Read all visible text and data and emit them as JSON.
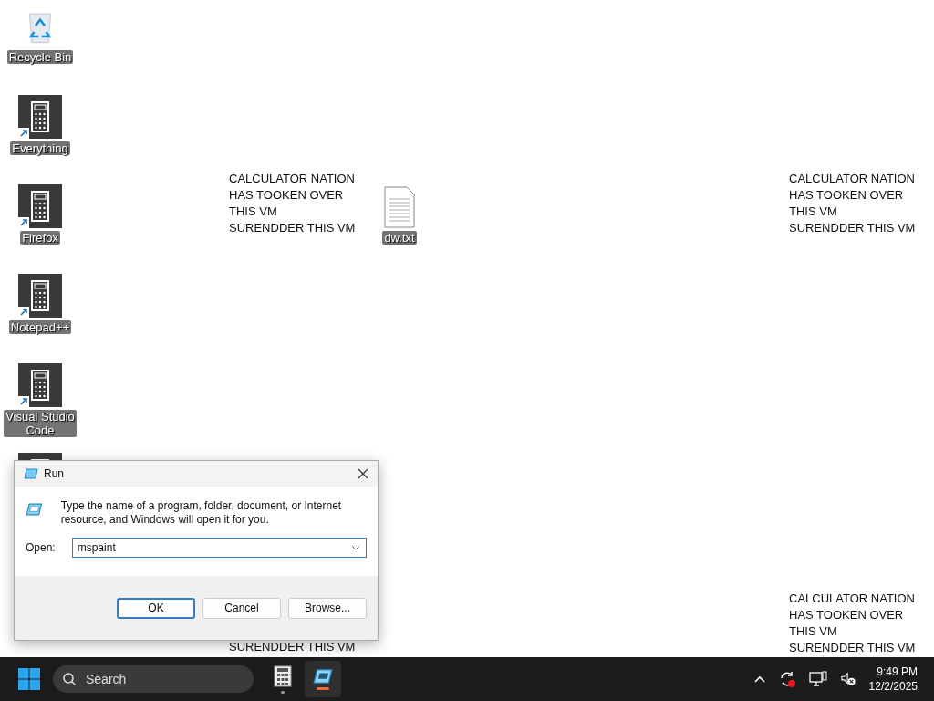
{
  "desktop_icons": [
    {
      "kind": "recycle",
      "label": "Recycle Bin"
    },
    {
      "kind": "app",
      "label": "Everything",
      "shortcut": true
    },
    {
      "kind": "app",
      "label": "Firefox",
      "shortcut": true
    },
    {
      "kind": "app",
      "label": "Notepad++",
      "shortcut": true
    },
    {
      "kind": "app",
      "label": "Visual Studio Code",
      "shortcut": true
    },
    {
      "kind": "app"
    },
    {
      "kind": "file",
      "label": "dw.txt"
    }
  ],
  "desktop_notes": [
    {
      "text": "CALCULATOR NATION\nHAS TOOKEN OVER\nTHIS VM\nSURENDDER THIS VM"
    },
    {
      "text": "SURENDDER THIS VM"
    },
    {
      "text": "CALCULATOR NATION\nHAS TOOKEN OVER\nTHIS VM\nSURENDDER THIS VM"
    },
    {
      "text": "CALCULATOR NATION\nHAS TOOKEN OVER\nTHIS VM\nSURENDDER THIS VM"
    }
  ],
  "run_dialog": {
    "title": "Run",
    "description": "Type the name of a program, folder, document, or Internet resource, and Windows will open it for you.",
    "open_label": "Open:",
    "value": "mspaint",
    "buttons": [
      {
        "label": "OK",
        "default": true
      },
      {
        "label": "Cancel",
        "default": false
      },
      {
        "label": "Browse...",
        "default": false
      }
    ]
  },
  "taskbar": {
    "search": {
      "placeholder": "Search"
    },
    "apps": [
      {
        "kind": "calculator",
        "selected": false
      },
      {
        "kind": "run",
        "selected": true
      }
    ],
    "tray": {
      "time": "9:49 PM",
      "date": "12/2/2025"
    }
  }
}
